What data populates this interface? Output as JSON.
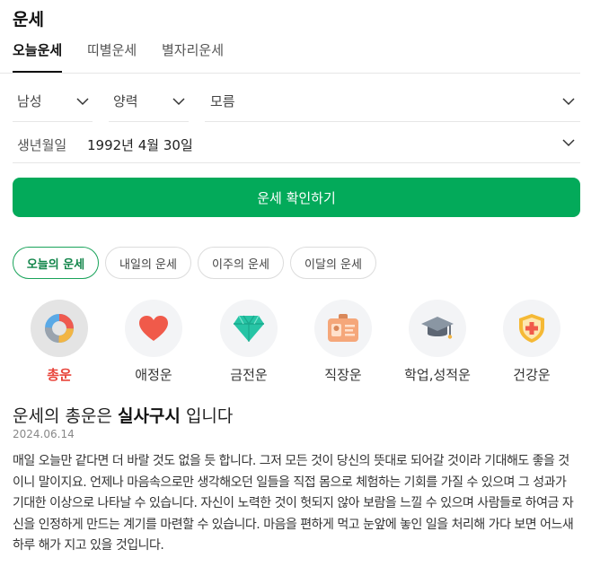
{
  "header": {
    "title": "운세"
  },
  "tabs": [
    {
      "label": "오늘운세",
      "active": true
    },
    {
      "label": "띠별운세",
      "active": false
    },
    {
      "label": "별자리운세",
      "active": false
    }
  ],
  "form": {
    "gender": "남성",
    "calendar": "양력",
    "birth_time": "모름",
    "birth_label": "생년월일",
    "birth_value": "1992년 4월 30일"
  },
  "cta": {
    "label": "운세 확인하기",
    "color": "#03aa5a"
  },
  "period_chips": [
    {
      "label": "오늘의 운세",
      "active": true
    },
    {
      "label": "내일의 운세",
      "active": false
    },
    {
      "label": "이주의 운세",
      "active": false
    },
    {
      "label": "이달의 운세",
      "active": false
    }
  ],
  "categories": [
    {
      "label": "총운",
      "icon": "donut-chart-icon",
      "active": true
    },
    {
      "label": "애정운",
      "icon": "heart-icon",
      "active": false
    },
    {
      "label": "금전운",
      "icon": "gem-icon",
      "active": false
    },
    {
      "label": "직장운",
      "icon": "id-badge-icon",
      "active": false
    },
    {
      "label": "학업,성적운",
      "icon": "graduation-cap-icon",
      "active": false
    },
    {
      "label": "건강운",
      "icon": "health-shield-icon",
      "active": false
    }
  ],
  "result": {
    "prefix": "운세의 총운은",
    "highlight": "실사구시",
    "suffix": "입니다",
    "date": "2024.06.14",
    "body": "매일 오늘만 같다면 더 바랄 것도 없을 듯 합니다. 그저 모든 것이 당신의 뜻대로 되어갈 것이라 기대해도 좋을 것이니 말이지요. 언제나 마음속으로만 생각해오던 일들을 직접 몸으로 체험하는 기회를 가질 수 있으며 그 성과가 기대한 이상으로 나타날 수 있습니다. 자신이 노력한 것이 헛되지 않아 보람을 느낄 수 있으며 사람들로 하여금 자신을 인정하게 만드는 계기를 마련할 수 있습니다. 마음을 편하게 먹고 눈앞에 놓인 일을 처리해 가다 보면 어느새 하루 해가 지고 있을 것입니다."
  }
}
